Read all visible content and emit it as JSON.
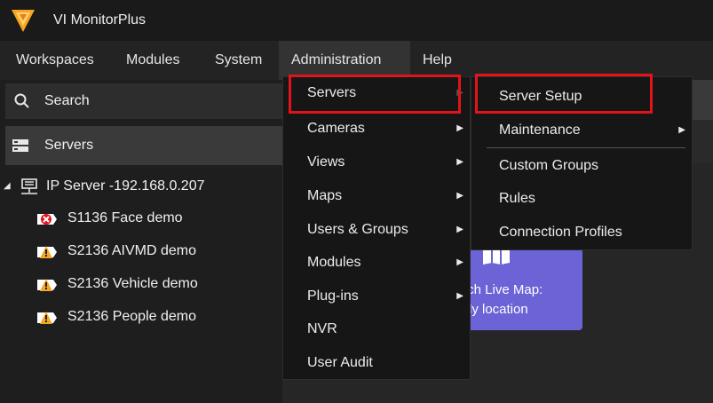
{
  "app": {
    "title": "VI MonitorPlus"
  },
  "menubar": {
    "items": [
      "Workspaces",
      "Modules",
      "System",
      "Administration",
      "Help"
    ]
  },
  "leftpanel": {
    "search_label": "Search",
    "servers_label": "Servers",
    "server_node": "IP Server -192.168.0.207",
    "cameras": [
      {
        "label": "S1136 Face demo",
        "status": "error"
      },
      {
        "label": "S2136 AIVMD demo",
        "status": "warning"
      },
      {
        "label": "S2136 Vehicle demo",
        "status": "warning"
      },
      {
        "label": "S2136 People demo",
        "status": "warning"
      }
    ]
  },
  "admin_menu": {
    "items": [
      "Servers",
      "Cameras",
      "Views",
      "Maps",
      "Users & Groups",
      "Modules",
      "Plug-ins",
      "NVR",
      "User Audit"
    ]
  },
  "servers_submenu": {
    "items": [
      "Server Setup",
      "Maintenance",
      "Custom Groups",
      "Rules",
      "Connection Profiles"
    ]
  },
  "live_map_card": {
    "line1": "ıch Live Map:",
    "line2": "ly location"
  },
  "colors": {
    "highlight": "#e3131b",
    "card": "#6b63d6",
    "logo": "#f5a623"
  }
}
